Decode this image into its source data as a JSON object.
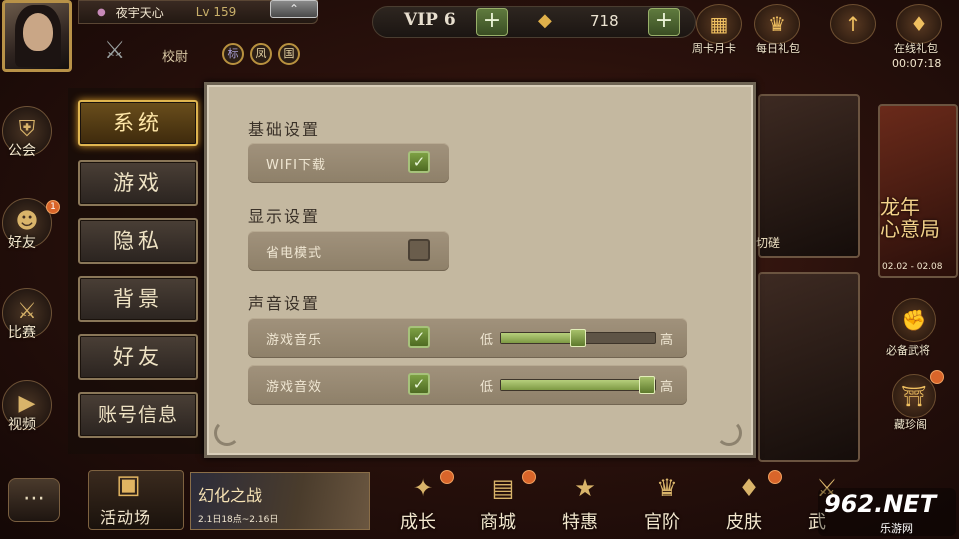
{
  "player": {
    "name": "夜宇天心",
    "level": "Lv 159",
    "rank_title": "校尉",
    "badges": [
      "标",
      "凤",
      "国"
    ],
    "collapse_icon": "double-chevron-up"
  },
  "currency": {
    "vip_label": "VIP 6",
    "gold_value": "718"
  },
  "top_icons": [
    {
      "label": "周卡月卡",
      "icon": "card-icon"
    },
    {
      "label": "每日礼包",
      "icon": "giftbag-icon"
    },
    {
      "label": "",
      "icon": "pagoda-icon"
    },
    {
      "label": "在线礼包",
      "icon": "gift-icon"
    }
  ],
  "online_timer": "00:07:18",
  "left_nav": [
    {
      "label": "公会",
      "icon": "guild-icon"
    },
    {
      "label": "好友",
      "icon": "friends-icon",
      "badge": "1"
    },
    {
      "label": "比赛",
      "icon": "crossed-swords-icon"
    },
    {
      "label": "视频",
      "icon": "play-icon"
    }
  ],
  "settings": {
    "menu": [
      "系统",
      "游戏",
      "隐私",
      "背景",
      "好友",
      "账号信息"
    ],
    "active_menu": "系统",
    "sections": [
      {
        "title": "基础设置",
        "rows": [
          {
            "label": "WIFI下载",
            "checked": true
          }
        ]
      },
      {
        "title": "显示设置",
        "rows": [
          {
            "label": "省电模式",
            "checked": false
          }
        ]
      },
      {
        "title": "声音设置",
        "rows": [
          {
            "label": "游戏音乐",
            "checked": true,
            "low": "低",
            "high": "高",
            "level": 0.5
          },
          {
            "label": "游戏音效",
            "checked": true,
            "low": "低",
            "high": "高",
            "level": 1.0
          }
        ]
      }
    ]
  },
  "right_panel": {
    "card_text": "切磋",
    "event_title_line1": "龙年",
    "event_title_line2": "心意局",
    "event_dates": "02.02 - 02.08",
    "icons": [
      {
        "label": "必备武将",
        "icon": "fist-icon"
      },
      {
        "label": "藏珍阁",
        "icon": "treasure-pavilion-icon"
      }
    ]
  },
  "bottom_bar": {
    "activity_label": "活动场",
    "banner_title": "幻化之战",
    "banner_sub": "2.1日18点~2.16日",
    "items": [
      {
        "label": "成长",
        "icon": "growth-icon"
      },
      {
        "label": "商城",
        "icon": "shop-icon"
      },
      {
        "label": "特惠",
        "icon": "discount-icon"
      },
      {
        "label": "官阶",
        "icon": "official-rank-icon"
      },
      {
        "label": "皮肤",
        "icon": "skin-icon"
      },
      {
        "label": "武",
        "icon": "weapon-icon"
      }
    ]
  },
  "watermark": {
    "logo": "962.NET",
    "sub": "乐游网"
  },
  "colors": {
    "accent_gold": "#e0b650",
    "panel_bg": "#c4b8a0",
    "check_green": "#7da044"
  }
}
